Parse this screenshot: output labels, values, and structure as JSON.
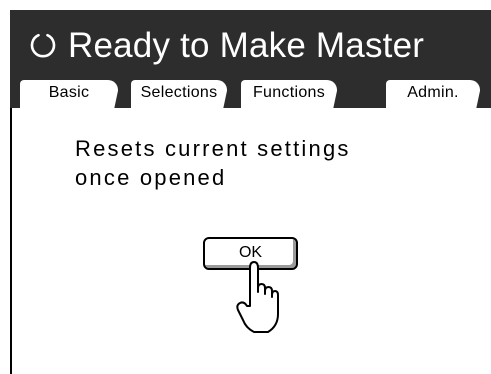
{
  "header": {
    "title": "Ready to Make Master",
    "status_icon": "ready-ring-icon"
  },
  "tabs": [
    {
      "label": "Basic"
    },
    {
      "label": "Selections"
    },
    {
      "label": "Functions"
    },
    {
      "label": "Admin."
    }
  ],
  "dialog": {
    "message_line1": "Resets current settings",
    "message_line2": "once opened",
    "ok_label": "OK",
    "pointer_icon": "pointing-hand-icon"
  },
  "colors": {
    "header_bg": "#2d2d2d",
    "header_text": "#ffffff",
    "background": "#ffffff"
  }
}
